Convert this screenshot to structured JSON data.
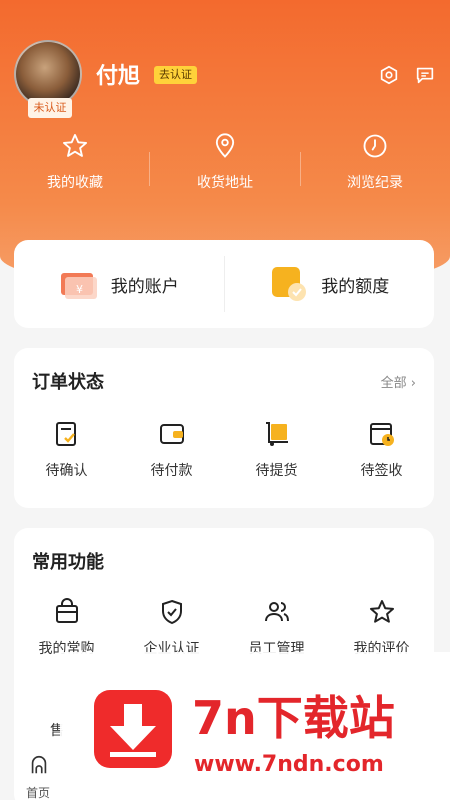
{
  "header": {
    "user_name": "付旭",
    "avatar_tag": "未认证",
    "cert_badge": "去认证",
    "icons": [
      "settings-icon",
      "message-icon"
    ]
  },
  "quick_links": [
    {
      "label": "我的收藏",
      "icon": "star-icon"
    },
    {
      "label": "收货地址",
      "icon": "location-pin-icon"
    },
    {
      "label": "浏览纪录",
      "icon": "clock-icon"
    }
  ],
  "accounts": [
    {
      "label": "我的账户",
      "icon": "wallet-card-icon"
    },
    {
      "label": "我的额度",
      "icon": "quota-icon"
    }
  ],
  "orders": {
    "title": "订单状态",
    "all_label": "全部",
    "items": [
      {
        "label": "待确认",
        "icon": "confirm-doc-icon"
      },
      {
        "label": "待付款",
        "icon": "wallet-icon"
      },
      {
        "label": "待提货",
        "icon": "package-icon"
      },
      {
        "label": "待签收",
        "icon": "sign-clock-icon"
      }
    ]
  },
  "functions": {
    "title": "常用功能",
    "items": [
      {
        "label": "我的常购",
        "icon": "shopping-bag-icon"
      },
      {
        "label": "企业认证",
        "icon": "shield-check-icon"
      },
      {
        "label": "员工管理",
        "icon": "users-icon"
      },
      {
        "label": "我的评价",
        "icon": "star-outline-icon"
      }
    ],
    "partial_label": "售"
  },
  "bottom_nav": {
    "home_label": "首页"
  },
  "watermark": {
    "name": "7n下载站",
    "url": "www.7ndn.com"
  },
  "colors": {
    "header_orange": "#f36a2e",
    "accent_yellow": "#f6b21f",
    "watermark_red": "#e3262b"
  }
}
